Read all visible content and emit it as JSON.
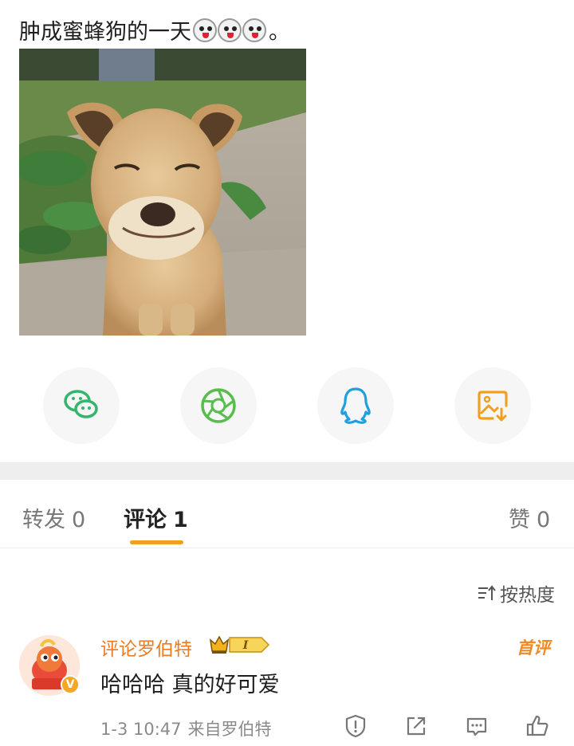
{
  "post": {
    "text": "肿成蜜蜂狗的一天",
    "period": "。",
    "emoji_count": 3,
    "emoji_name": "doge-tongue-emoji"
  },
  "share": {
    "items": [
      {
        "name": "wechat-share-button",
        "icon": "wechat-icon",
        "color": "#35b46c"
      },
      {
        "name": "moments-share-button",
        "icon": "moments-icon",
        "color": "#58bd4c"
      },
      {
        "name": "qq-share-button",
        "icon": "qq-icon",
        "color": "#1e9fe0"
      },
      {
        "name": "save-image-button",
        "icon": "save-image-icon",
        "color": "#f0a020"
      }
    ]
  },
  "tabs": {
    "repost_label": "转发",
    "repost_count": "0",
    "comment_label": "评论",
    "comment_count": "1",
    "like_label": "赞",
    "like_count": "0",
    "accent": "#f0a020"
  },
  "sort": {
    "label": "按热度"
  },
  "comment": {
    "username": "评论罗伯特",
    "level": "I",
    "first_tag": "首评",
    "text": "哈哈哈 真的好可爱",
    "time": "1-3 10:47",
    "source": "来自罗伯特",
    "verified_mark": "V",
    "username_color": "#eb7b1e"
  }
}
